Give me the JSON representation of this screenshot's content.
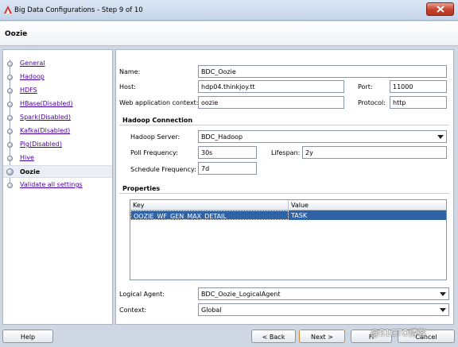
{
  "window": {
    "title": "Big Data Configurations - Step 9 of 10"
  },
  "page": {
    "title": "Oozie"
  },
  "nav": {
    "items": [
      {
        "label": "General",
        "current": false
      },
      {
        "label": "Hadoop",
        "current": false
      },
      {
        "label": "HDFS",
        "current": false
      },
      {
        "label": "HBase(Disabled)",
        "current": false
      },
      {
        "label": "Spark(Disabled)",
        "current": false
      },
      {
        "label": "Kafka(Disabled)",
        "current": false
      },
      {
        "label": "Pig(Disabled)",
        "current": false
      },
      {
        "label": "Hive",
        "current": false
      },
      {
        "label": "Oozie",
        "current": true
      },
      {
        "label": "Validate all settings",
        "current": false
      }
    ]
  },
  "form": {
    "name": {
      "label": "Name:",
      "value": "BDC_Oozie"
    },
    "host": {
      "label": "Host:",
      "value": "hdp04.thinkjoy.tt"
    },
    "port": {
      "label": "Port:",
      "value": "11000"
    },
    "webctx": {
      "label": "Web application context:",
      "value": "oozie"
    },
    "protocol": {
      "label": "Protocol:",
      "value": "http"
    },
    "hadoop_section": "Hadoop Connection",
    "hadoop_server": {
      "label": "Hadoop Server:",
      "value": "BDC_Hadoop"
    },
    "poll": {
      "label": "Poll Frequency:",
      "value": "30s"
    },
    "lifespan": {
      "label": "Lifespan:",
      "value": "2y"
    },
    "schedule": {
      "label": "Schedule Frequency:",
      "value": "7d"
    },
    "properties_section": "Properties",
    "properties": {
      "columns": [
        "Key",
        "Value"
      ],
      "rows": [
        {
          "key": "OOZIE_WF_GEN_MAX_DETAIL",
          "value": "TASK"
        }
      ]
    },
    "logical_agent": {
      "label": "Logical Agent:",
      "value": "BDC_Oozie_LogicalAgent"
    },
    "context": {
      "label": "Context:",
      "value": "Global"
    }
  },
  "footer": {
    "help": "Help",
    "back": "< Back",
    "next": "Next >",
    "finish": "Fi",
    "cancel": "Cancel"
  },
  "watermark": "@51CTO博客",
  "colors": {
    "selection": "#3062a6",
    "nav_link": "#4a00a0",
    "close": "#c5412c"
  }
}
